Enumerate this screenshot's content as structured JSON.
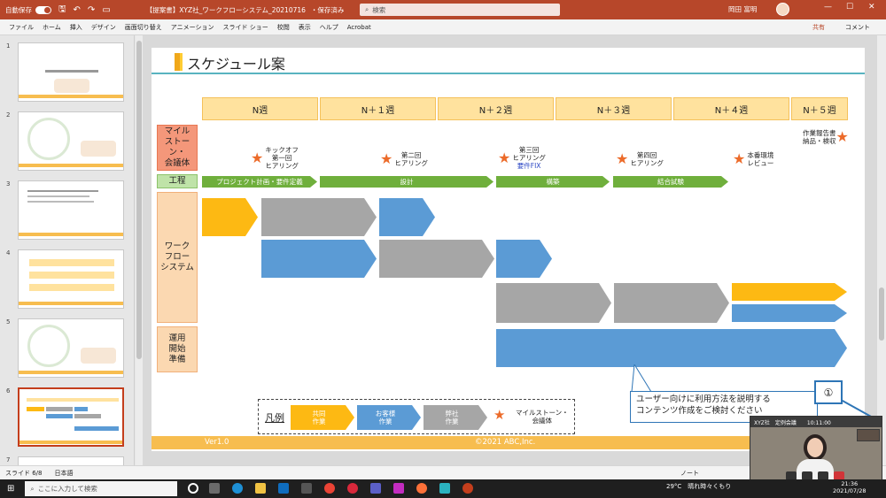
{
  "titlebar": {
    "autosave": "自動保存",
    "autosave_state": "オン",
    "doc_title": "【提案書】XYZ社_ワークフローシステム_20210716",
    "save_status": "・保存済み",
    "search_placeholder": "検索",
    "user_name": "岡田 富明"
  },
  "menu": {
    "items": [
      "ファイル",
      "ホーム",
      "挿入",
      "デザイン",
      "画面切り替え",
      "アニメーション",
      "スライド ショー",
      "校閲",
      "表示",
      "ヘルプ",
      "Acrobat"
    ],
    "share": "共有",
    "comment": "コメント"
  },
  "thumbnails": {
    "numbers": [
      "1",
      "2",
      "3",
      "4",
      "5",
      "6",
      "7"
    ],
    "active_index": 5
  },
  "slide": {
    "title": "スケジュール案",
    "weeks": [
      "N週",
      "N＋１週",
      "N＋２週",
      "N＋３週",
      "N＋４週",
      "N＋５週"
    ],
    "row_labels": {
      "milestone": "マイル\nストーン・\n会議体",
      "process": "工程",
      "workflow": "ワーク\nフロー\nシステム",
      "operation": "運用\n開始\n準備"
    },
    "milestones": [
      {
        "text": "キックオフ\n第一回\nヒアリング"
      },
      {
        "text": "第二回\nヒアリング"
      },
      {
        "text": "第三回\nヒアリング",
        "sub": "要件FIX"
      },
      {
        "text": "第四回\nヒアリング"
      },
      {
        "text": "本番環境\nレビュー"
      },
      {
        "text": "作業報告書\n納品・検収"
      }
    ],
    "phases": [
      "プロジェクト計画・要件定義",
      "設計",
      "構築",
      "結合試験"
    ],
    "legend": {
      "title": "凡例",
      "joint": "共同\n作業",
      "customer": "お客様\n作業",
      "ours": "弊社\n作業",
      "milestone": "マイルストーン・\n会議体"
    },
    "callout": "ユーザー向けに利用方法を説明する\nコンテンツ作成をご検討ください",
    "footer_version": "Ver1.0",
    "footer_copyright": "©2021 ABC,Inc."
  },
  "marker": "①",
  "statusbar": {
    "slide_info": "スライド 6/8",
    "language": "日本語",
    "notes": "ノート"
  },
  "video": {
    "title": "XYZ社　定例会議",
    "time": "10:11:00"
  },
  "taskbar": {
    "search_placeholder": "ここに入力して検索",
    "weather": "29°C　晴れ時々くもり",
    "time": "21:36",
    "date": "2021/07/28"
  },
  "colors": {
    "ppt_red": "#b7472a",
    "joint": "#fdb913",
    "customer": "#5b9bd5",
    "ours": "#a6a6a6",
    "phase_green": "#6faf3c",
    "star": "#ec6b2a"
  }
}
